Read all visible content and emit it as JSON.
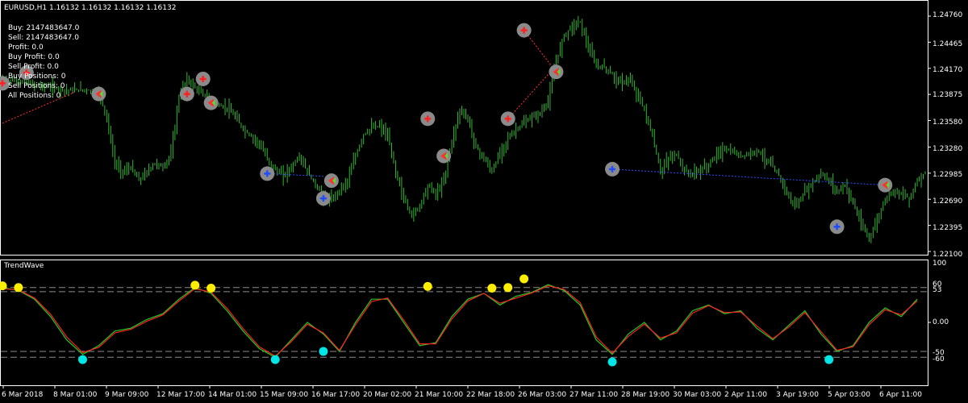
{
  "window": {
    "title": "EURUSD,H1  1.16132 1.16132 1.16132 1.16132",
    "indicator_title": "TrendWave"
  },
  "info_panel": [
    "Buy: 2147483647.0",
    "Sell: 2147483647.0",
    "Profit: 0.0",
    "Buy Profit: 0.0",
    "Sell Profit: 0.0",
    "Buy Positions: 0",
    "Sell Positions: 0",
    "All Positions: 0"
  ],
  "colors": {
    "background": "#000000",
    "candles": "#2db82d",
    "osc_green": "#22cc22",
    "osc_red": "#ff2020",
    "buy_arrow": "#1e4dff",
    "sell_arrow": "#ff2020",
    "marker_ring": "#8a8a8a",
    "osc_top_dot": "#ffee00",
    "osc_bottom_dot": "#00e5e5",
    "level_line": "#8c8c8c"
  },
  "chart_data": [
    {
      "type": "candlestick",
      "title": "EURUSD,H1",
      "y_ticks": [
        "1.24760",
        "1.24465",
        "1.24170",
        "1.23875",
        "1.23580",
        "1.23280",
        "1.22985",
        "1.22690",
        "1.22395",
        "1.22100"
      ],
      "ylim": [
        1.221,
        1.2476
      ],
      "x_ticks": [
        "6 Mar 2018",
        "8 Mar 01:00",
        "9 Mar 09:00",
        "12 Mar 17:00",
        "14 Mar 01:00",
        "15 Mar 09:00",
        "16 Mar 17:00",
        "20 Mar 02:00",
        "21 Mar 10:00",
        "22 Mar 18:00",
        "26 Mar 03:00",
        "27 Mar 11:00",
        "28 Mar 19:00",
        "30 Mar 03:00",
        "2 Apr 11:00",
        "3 Apr 19:00",
        "5 Apr 03:00",
        "6 Apr 11:00"
      ],
      "close_path": [
        [
          0,
          1.2405
        ],
        [
          4,
          1.2402
        ],
        [
          8,
          1.2398
        ],
        [
          12,
          1.2396
        ],
        [
          16,
          1.2392
        ],
        [
          20,
          1.2393
        ],
        [
          24,
          1.239
        ],
        [
          26,
          1.236
        ],
        [
          28,
          1.231
        ],
        [
          30,
          1.23
        ],
        [
          32,
          1.2305
        ],
        [
          34,
          1.229
        ],
        [
          36,
          1.23
        ],
        [
          38,
          1.231
        ],
        [
          40,
          1.2305
        ],
        [
          42,
          1.232
        ],
        [
          44,
          1.2385
        ],
        [
          46,
          1.2405
        ],
        [
          48,
          1.2395
        ],
        [
          50,
          1.2388
        ],
        [
          52,
          1.238
        ],
        [
          54,
          1.2375
        ],
        [
          56,
          1.2372
        ],
        [
          58,
          1.2362
        ],
        [
          60,
          1.2348
        ],
        [
          62,
          1.234
        ],
        [
          64,
          1.2332
        ],
        [
          66,
          1.2315
        ],
        [
          68,
          1.2302
        ],
        [
          70,
          1.2296
        ],
        [
          72,
          1.2305
        ],
        [
          74,
          1.2318
        ],
        [
          76,
          1.23
        ],
        [
          78,
          1.2285
        ],
        [
          80,
          1.2272
        ],
        [
          82,
          1.2268
        ],
        [
          84,
          1.228
        ],
        [
          86,
          1.229
        ],
        [
          88,
          1.2318
        ],
        [
          90,
          1.2342
        ],
        [
          92,
          1.235
        ],
        [
          94,
          1.2352
        ],
        [
          96,
          1.234
        ],
        [
          98,
          1.23
        ],
        [
          100,
          1.227
        ],
        [
          102,
          1.225
        ],
        [
          104,
          1.2262
        ],
        [
          106,
          1.2285
        ],
        [
          108,
          1.2275
        ],
        [
          110,
          1.229
        ],
        [
          112,
          1.2335
        ],
        [
          114,
          1.237
        ],
        [
          116,
          1.236
        ],
        [
          118,
          1.2328
        ],
        [
          120,
          1.2315
        ],
        [
          122,
          1.23
        ],
        [
          124,
          1.2322
        ],
        [
          126,
          1.2338
        ],
        [
          128,
          1.2348
        ],
        [
          130,
          1.2355
        ],
        [
          132,
          1.2362
        ],
        [
          134,
          1.2366
        ],
        [
          136,
          1.238
        ],
        [
          138,
          1.2425
        ],
        [
          140,
          1.2455
        ],
        [
          142,
          1.2465
        ],
        [
          144,
          1.247
        ],
        [
          146,
          1.244
        ],
        [
          148,
          1.242
        ],
        [
          150,
          1.2418
        ],
        [
          152,
          1.241
        ],
        [
          154,
          1.24
        ],
        [
          156,
          1.2405
        ],
        [
          158,
          1.239
        ],
        [
          160,
          1.237
        ],
        [
          162,
          1.234
        ],
        [
          164,
          1.23
        ],
        [
          166,
          1.2315
        ],
        [
          168,
          1.232
        ],
        [
          170,
          1.23
        ],
        [
          172,
          1.2298
        ],
        [
          174,
          1.2302
        ],
        [
          176,
          1.2308
        ],
        [
          178,
          1.232
        ],
        [
          180,
          1.2326
        ],
        [
          182,
          1.2322
        ],
        [
          184,
          1.2318
        ],
        [
          186,
          1.232
        ],
        [
          188,
          1.2325
        ],
        [
          190,
          1.2315
        ],
        [
          192,
          1.2305
        ],
        [
          194,
          1.2292
        ],
        [
          196,
          1.227
        ],
        [
          198,
          1.2262
        ],
        [
          200,
          1.2278
        ],
        [
          202,
          1.2288
        ],
        [
          204,
          1.2298
        ],
        [
          206,
          1.229
        ],
        [
          208,
          1.2278
        ],
        [
          210,
          1.2285
        ],
        [
          212,
          1.2265
        ],
        [
          214,
          1.224
        ],
        [
          216,
          1.2225
        ],
        [
          218,
          1.2245
        ],
        [
          220,
          1.227
        ],
        [
          222,
          1.228
        ],
        [
          224,
          1.2275
        ],
        [
          226,
          1.227
        ],
        [
          228,
          1.229
        ],
        [
          230,
          1.23
        ]
      ],
      "trade_markers": [
        {
          "t": 0,
          "price": 1.24,
          "kind": "sell"
        },
        {
          "t": 6,
          "price": 1.2412,
          "kind": "sell"
        },
        {
          "t": 24,
          "price": 1.2388,
          "kind": "close"
        },
        {
          "t": 46,
          "price": 1.2388,
          "kind": "sell"
        },
        {
          "t": 50,
          "price": 1.2405,
          "kind": "sell"
        },
        {
          "t": 52,
          "price": 1.2378,
          "kind": "close"
        },
        {
          "t": 66,
          "price": 1.2298,
          "kind": "buy"
        },
        {
          "t": 80,
          "price": 1.227,
          "kind": "buy"
        },
        {
          "t": 82,
          "price": 1.229,
          "kind": "close"
        },
        {
          "t": 106,
          "price": 1.236,
          "kind": "sell"
        },
        {
          "t": 110,
          "price": 1.2318,
          "kind": "close"
        },
        {
          "t": 126,
          "price": 1.236,
          "kind": "sell"
        },
        {
          "t": 130,
          "price": 1.246,
          "kind": "sell"
        },
        {
          "t": 138,
          "price": 1.2413,
          "kind": "close"
        },
        {
          "t": 152,
          "price": 1.2303,
          "kind": "buy"
        },
        {
          "t": 208,
          "price": 1.2238,
          "kind": "buy"
        },
        {
          "t": 220,
          "price": 1.2285,
          "kind": "close"
        }
      ],
      "trade_links": [
        {
          "from": [
            0,
            1.2355
          ],
          "to": [
            18,
            1.239
          ],
          "color": "red"
        },
        {
          "from": [
            130,
            1.246
          ],
          "to": [
            138,
            1.2413
          ],
          "color": "red"
        },
        {
          "from": [
            126,
            1.236
          ],
          "to": [
            136,
            1.241
          ],
          "color": "red"
        },
        {
          "from": [
            66,
            1.2298
          ],
          "to": [
            80,
            1.2295
          ],
          "color": "blue"
        },
        {
          "from": [
            152,
            1.2303
          ],
          "to": [
            220,
            1.2285
          ],
          "color": "blue"
        }
      ]
    },
    {
      "type": "line",
      "title": "TrendWave",
      "y_ticks": [
        "100",
        "60",
        "53",
        "0.00",
        "-50",
        "-60"
      ],
      "levels": [
        60,
        53,
        -50,
        -60
      ],
      "ylim": [
        -100,
        100
      ],
      "series": [
        {
          "color": "green",
          "values": [
            [
              0,
              60
            ],
            [
              4,
              55
            ],
            [
              8,
              40
            ],
            [
              12,
              10
            ],
            [
              16,
              -30
            ],
            [
              20,
              -55
            ],
            [
              24,
              -40
            ],
            [
              28,
              -15
            ],
            [
              32,
              -10
            ],
            [
              36,
              5
            ],
            [
              40,
              15
            ],
            [
              44,
              40
            ],
            [
              48,
              60
            ],
            [
              52,
              50
            ],
            [
              56,
              20
            ],
            [
              60,
              -15
            ],
            [
              64,
              -45
            ],
            [
              68,
              -60
            ],
            [
              72,
              -30
            ],
            [
              76,
              0
            ],
            [
              80,
              -20
            ],
            [
              84,
              -50
            ],
            [
              88,
              0
            ],
            [
              92,
              40
            ],
            [
              96,
              40
            ],
            [
              100,
              0
            ],
            [
              104,
              -40
            ],
            [
              108,
              -35
            ],
            [
              112,
              10
            ],
            [
              116,
              40
            ],
            [
              120,
              50
            ],
            [
              124,
              30
            ],
            [
              128,
              45
            ],
            [
              132,
              52
            ],
            [
              136,
              65
            ],
            [
              140,
              55
            ],
            [
              144,
              30
            ],
            [
              148,
              -30
            ],
            [
              152,
              -55
            ],
            [
              156,
              -20
            ],
            [
              160,
              0
            ],
            [
              164,
              -30
            ],
            [
              168,
              -15
            ],
            [
              172,
              20
            ],
            [
              176,
              30
            ],
            [
              180,
              15
            ],
            [
              184,
              20
            ],
            [
              188,
              -10
            ],
            [
              192,
              -30
            ],
            [
              196,
              -5
            ],
            [
              200,
              20
            ],
            [
              204,
              -20
            ],
            [
              208,
              -50
            ],
            [
              212,
              -40
            ],
            [
              216,
              0
            ],
            [
              220,
              25
            ],
            [
              224,
              10
            ],
            [
              228,
              40
            ]
          ]
        },
        {
          "color": "red",
          "values": [
            [
              0,
              58
            ],
            [
              4,
              56
            ],
            [
              8,
              42
            ],
            [
              12,
              14
            ],
            [
              16,
              -25
            ],
            [
              20,
              -52
            ],
            [
              24,
              -43
            ],
            [
              28,
              -18
            ],
            [
              32,
              -12
            ],
            [
              36,
              2
            ],
            [
              40,
              13
            ],
            [
              44,
              37
            ],
            [
              48,
              58
            ],
            [
              52,
              52
            ],
            [
              56,
              24
            ],
            [
              60,
              -11
            ],
            [
              64,
              -42
            ],
            [
              68,
              -58
            ],
            [
              72,
              -33
            ],
            [
              76,
              -3
            ],
            [
              80,
              -18
            ],
            [
              84,
              -48
            ],
            [
              88,
              -4
            ],
            [
              92,
              36
            ],
            [
              96,
              42
            ],
            [
              100,
              4
            ],
            [
              104,
              -37
            ],
            [
              108,
              -37
            ],
            [
              112,
              6
            ],
            [
              116,
              37
            ],
            [
              120,
              50
            ],
            [
              124,
              33
            ],
            [
              128,
              42
            ],
            [
              132,
              51
            ],
            [
              136,
              63
            ],
            [
              140,
              57
            ],
            [
              144,
              34
            ],
            [
              148,
              -25
            ],
            [
              152,
              -53
            ],
            [
              156,
              -24
            ],
            [
              160,
              -3
            ],
            [
              164,
              -27
            ],
            [
              168,
              -18
            ],
            [
              172,
              16
            ],
            [
              176,
              29
            ],
            [
              180,
              17
            ],
            [
              184,
              18
            ],
            [
              188,
              -6
            ],
            [
              192,
              -28
            ],
            [
              196,
              -8
            ],
            [
              200,
              17
            ],
            [
              204,
              -16
            ],
            [
              208,
              -48
            ],
            [
              212,
              -42
            ],
            [
              216,
              -4
            ],
            [
              220,
              22
            ],
            [
              224,
              13
            ],
            [
              228,
              37
            ]
          ]
        }
      ],
      "dots": [
        {
          "t": 0,
          "value": 63,
          "kind": "top"
        },
        {
          "t": 4,
          "value": 60,
          "kind": "top"
        },
        {
          "t": 20,
          "value": -64,
          "kind": "bottom"
        },
        {
          "t": 48,
          "value": 64,
          "kind": "top"
        },
        {
          "t": 52,
          "value": 59,
          "kind": "top"
        },
        {
          "t": 68,
          "value": -64,
          "kind": "bottom"
        },
        {
          "t": 80,
          "value": -50,
          "kind": "bottom"
        },
        {
          "t": 106,
          "value": 62,
          "kind": "top"
        },
        {
          "t": 122,
          "value": 59,
          "kind": "top"
        },
        {
          "t": 126,
          "value": 60,
          "kind": "top"
        },
        {
          "t": 130,
          "value": 75,
          "kind": "top"
        },
        {
          "t": 152,
          "value": -68,
          "kind": "bottom"
        },
        {
          "t": 206,
          "value": -64,
          "kind": "bottom"
        }
      ]
    }
  ]
}
